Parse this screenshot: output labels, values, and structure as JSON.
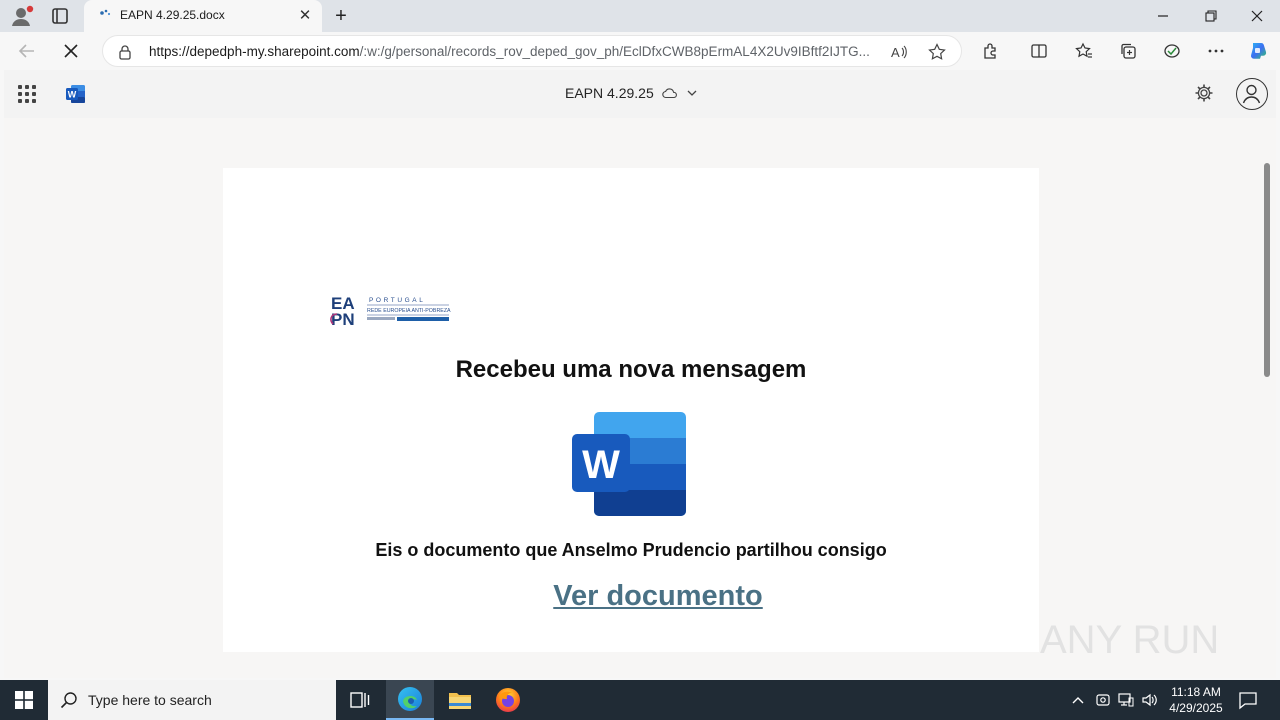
{
  "browser": {
    "tab_title": "EAPN 4.29.25.docx",
    "url_host": "https://depedph-my.sharepoint.com",
    "url_path": "/:w:/g/personal/records_rov_deped_gov_ph/EclDfxCWB8pErmAL4X2Uv9IBftf2IJTG..."
  },
  "office": {
    "doc_title": "EAPN 4.29.25"
  },
  "document": {
    "logo": {
      "letters_top": "EA",
      "letters_bottom": "PN",
      "line1": "PORTUGAL",
      "line2": "REDE EUROPEIA ANTI-POBREZA"
    },
    "headline": "Recebeu uma nova mensagem",
    "word_icon_letter": "W",
    "message": "Eis o documento que Anselmo Prudencio partilhou consigo",
    "link_text": "Ver documento"
  },
  "watermark": "ANY RUN",
  "taskbar": {
    "search_placeholder": "Type here to search",
    "time": "11:18 AM",
    "date": "4/29/2025"
  },
  "colors": {
    "accent": "#4a7185",
    "word_blue": "#185abd",
    "taskbar": "#202b35"
  }
}
